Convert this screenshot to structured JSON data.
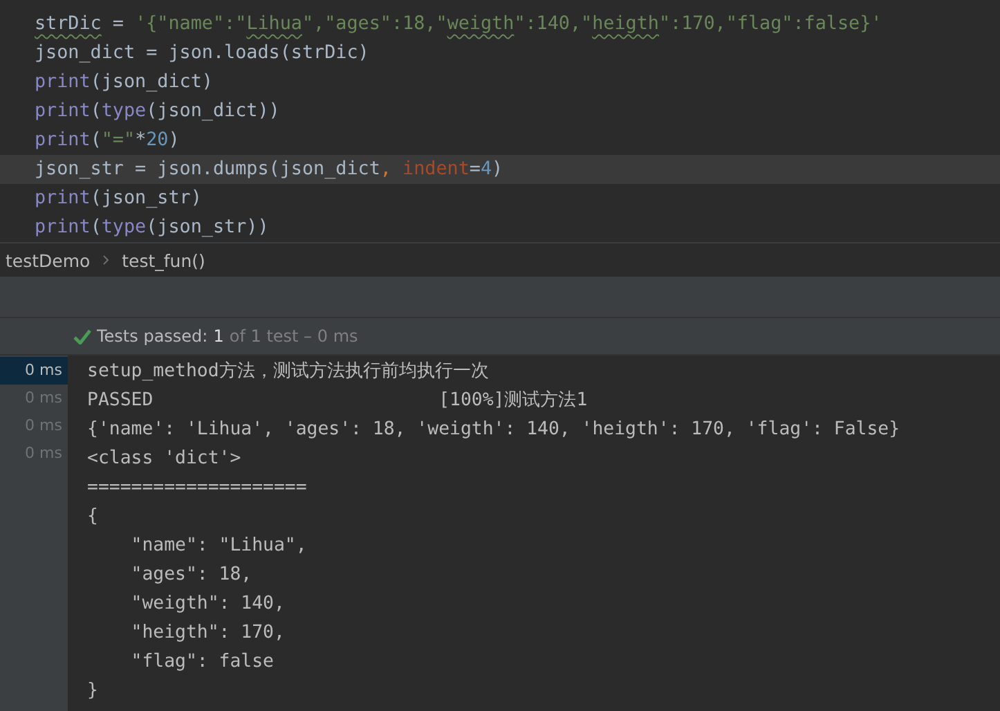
{
  "editor": {
    "lines": [
      {
        "current": false,
        "tokens": [
          {
            "kind": "typo",
            "text": "strDic"
          },
          {
            "kind": "plain",
            "text": " = "
          },
          {
            "kind": "string",
            "text": "'{\"name\":\""
          },
          {
            "kind": "string-typo",
            "text": "Lihua"
          },
          {
            "kind": "string",
            "text": "\",\"ages\":18,\""
          },
          {
            "kind": "string-typo",
            "text": "weigth"
          },
          {
            "kind": "string",
            "text": "\":140,\""
          },
          {
            "kind": "string-typo",
            "text": "heigth"
          },
          {
            "kind": "string",
            "text": "\":170,\"flag\":false}'"
          }
        ]
      },
      {
        "current": false,
        "tokens": [
          {
            "kind": "plain",
            "text": "json_dict = json.loads(strDic)"
          }
        ]
      },
      {
        "current": false,
        "tokens": [
          {
            "kind": "builtin",
            "text": "print"
          },
          {
            "kind": "plain",
            "text": "(json_dict)"
          }
        ]
      },
      {
        "current": false,
        "tokens": [
          {
            "kind": "builtin",
            "text": "print"
          },
          {
            "kind": "plain",
            "text": "("
          },
          {
            "kind": "builtin",
            "text": "type"
          },
          {
            "kind": "plain",
            "text": "(json_dict))"
          }
        ]
      },
      {
        "current": false,
        "tokens": [
          {
            "kind": "builtin",
            "text": "print"
          },
          {
            "kind": "plain",
            "text": "("
          },
          {
            "kind": "string",
            "text": "\"=\""
          },
          {
            "kind": "plain",
            "text": "*"
          },
          {
            "kind": "number",
            "text": "20"
          },
          {
            "kind": "plain",
            "text": ")"
          }
        ]
      },
      {
        "current": true,
        "tokens": [
          {
            "kind": "plain",
            "text": "json_str = json.dumps(json_dict"
          },
          {
            "kind": "punct",
            "text": ", "
          },
          {
            "kind": "param",
            "text": "indent"
          },
          {
            "kind": "plain",
            "text": "="
          },
          {
            "kind": "number",
            "text": "4"
          },
          {
            "kind": "plain",
            "text": ")"
          }
        ]
      },
      {
        "current": false,
        "tokens": [
          {
            "kind": "builtin",
            "text": "print"
          },
          {
            "kind": "plain",
            "text": "(json_str)"
          }
        ]
      },
      {
        "current": false,
        "tokens": [
          {
            "kind": "builtin",
            "text": "print"
          },
          {
            "kind": "plain",
            "text": "("
          },
          {
            "kind": "builtin",
            "text": "type"
          },
          {
            "kind": "plain",
            "text": "(json_str))"
          }
        ]
      }
    ]
  },
  "breadcrumb": [
    "testDemo",
    "test_fun()"
  ],
  "test_status": {
    "label": "Tests passed:",
    "count": "1",
    "detail": "of 1 test – 0 ms"
  },
  "console": {
    "durations": [
      {
        "text": "0 ms",
        "selected": true
      },
      {
        "text": "0 ms",
        "selected": false
      },
      {
        "text": "0 ms",
        "selected": false
      },
      {
        "text": "0 ms",
        "selected": false
      }
    ],
    "lines": [
      "setup_method方法，测试方法执行前均执行一次",
      "PASSED                          [100%]测试方法1",
      "{'name': 'Lihua', 'ages': 18, 'weigth': 140, 'heigth': 170, 'flag': False}",
      "<class 'dict'>",
      "====================",
      "{",
      "    \"name\": \"Lihua\",",
      "    \"ages\": 18,",
      "    \"weigth\": 140,",
      "    \"heigth\": 170,",
      "    \"flag\": false",
      "}"
    ]
  }
}
